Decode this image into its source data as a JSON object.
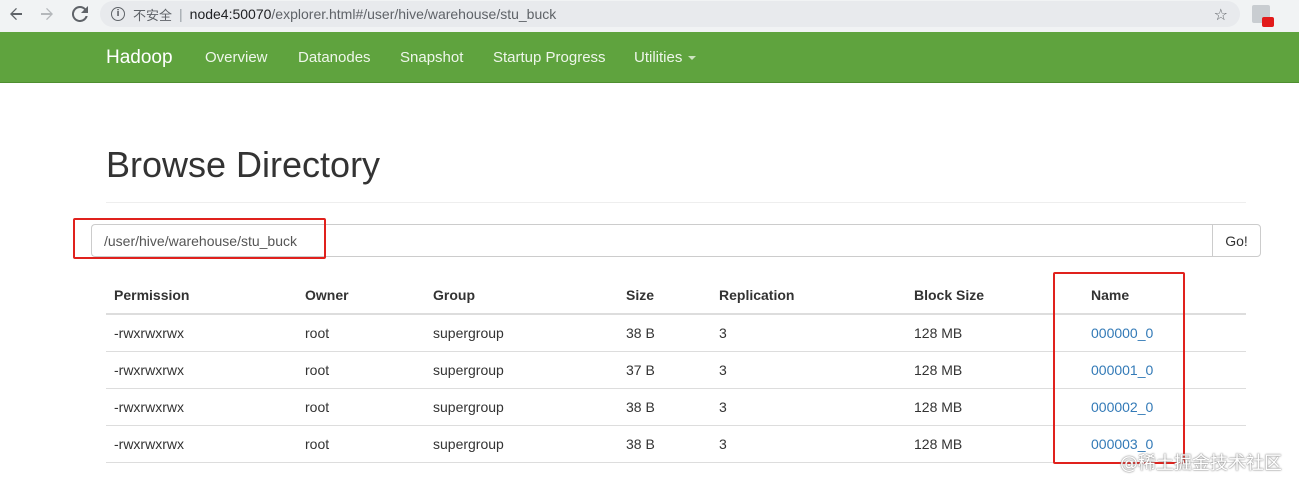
{
  "browser": {
    "security_label": "不安全",
    "url_host": "node4:50070",
    "url_rest": "/explorer.html#/user/hive/warehouse/stu_buck",
    "icons": [
      "back-icon",
      "forward-icon",
      "reload-icon",
      "info-icon",
      "star-icon",
      "extension-icon"
    ]
  },
  "navbar": {
    "brand": "Hadoop",
    "items": [
      "Overview",
      "Datanodes",
      "Snapshot",
      "Startup Progress",
      "Utilities"
    ]
  },
  "page": {
    "title": "Browse Directory",
    "path_value": "/user/hive/warehouse/stu_buck",
    "go_label": "Go!"
  },
  "table": {
    "headers": [
      "Permission",
      "Owner",
      "Group",
      "Size",
      "Replication",
      "Block Size",
      "Name"
    ],
    "rows": [
      [
        "-rwxrwxrwx",
        "root",
        "supergroup",
        "38 B",
        "3",
        "128 MB",
        "000000_0"
      ],
      [
        "-rwxrwxrwx",
        "root",
        "supergroup",
        "37 B",
        "3",
        "128 MB",
        "000001_0"
      ],
      [
        "-rwxrwxrwx",
        "root",
        "supergroup",
        "38 B",
        "3",
        "128 MB",
        "000002_0"
      ],
      [
        "-rwxrwxrwx",
        "root",
        "supergroup",
        "38 B",
        "3",
        "128 MB",
        "000003_0"
      ]
    ]
  },
  "watermark": "@稀土掘金技术社区",
  "colors": {
    "navbar": "#5fa33e",
    "link": "#337ab7",
    "annotation": "#e0211d"
  }
}
